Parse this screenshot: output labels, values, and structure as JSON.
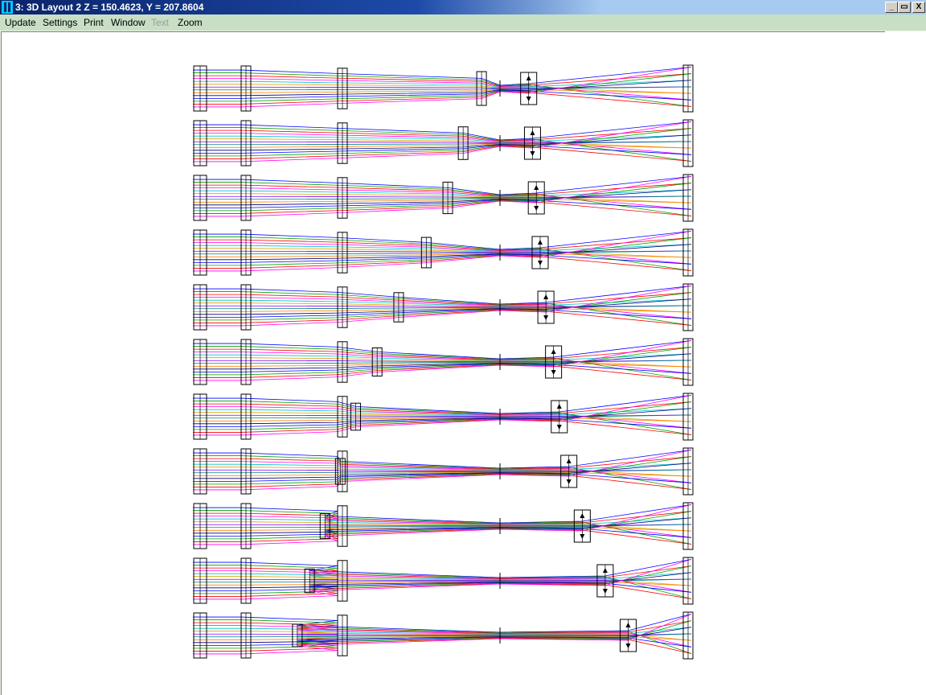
{
  "window": {
    "title": "3: 3D Layout 2 Z = 150.4623, Y = 207.8604",
    "icon": "zemax-app-icon",
    "buttons": {
      "minimize": "_",
      "restore": "▭",
      "close": "X"
    }
  },
  "menu": {
    "items": [
      {
        "key": "update",
        "label": "Update",
        "enabled": true
      },
      {
        "key": "settings",
        "label": "Settings",
        "enabled": true
      },
      {
        "key": "print",
        "label": "Print",
        "enabled": true
      },
      {
        "key": "window",
        "label": "Window",
        "enabled": true
      },
      {
        "key": "text",
        "label": "Text",
        "enabled": false
      },
      {
        "key": "zoom",
        "label": "Zoom",
        "enabled": true
      }
    ]
  },
  "layout": {
    "configurations": 11,
    "fixed_lens_groups": 3,
    "moving_group_positions": [
      0.94,
      0.88,
      0.83,
      0.76,
      0.67,
      0.6,
      0.53,
      0.48,
      0.43,
      0.38,
      0.34
    ],
    "zoom_group_positions": [
      0.15,
      0.17,
      0.19,
      0.21,
      0.24,
      0.28,
      0.31,
      0.36,
      0.43,
      0.55,
      0.67
    ],
    "ray_colors": [
      "#0000ff",
      "#00a000",
      "#ff0000",
      "#ff00ff",
      "#00c8c8",
      "#e0a000",
      "#8000ff",
      "#008080",
      "#ff8000",
      "#000080"
    ]
  }
}
